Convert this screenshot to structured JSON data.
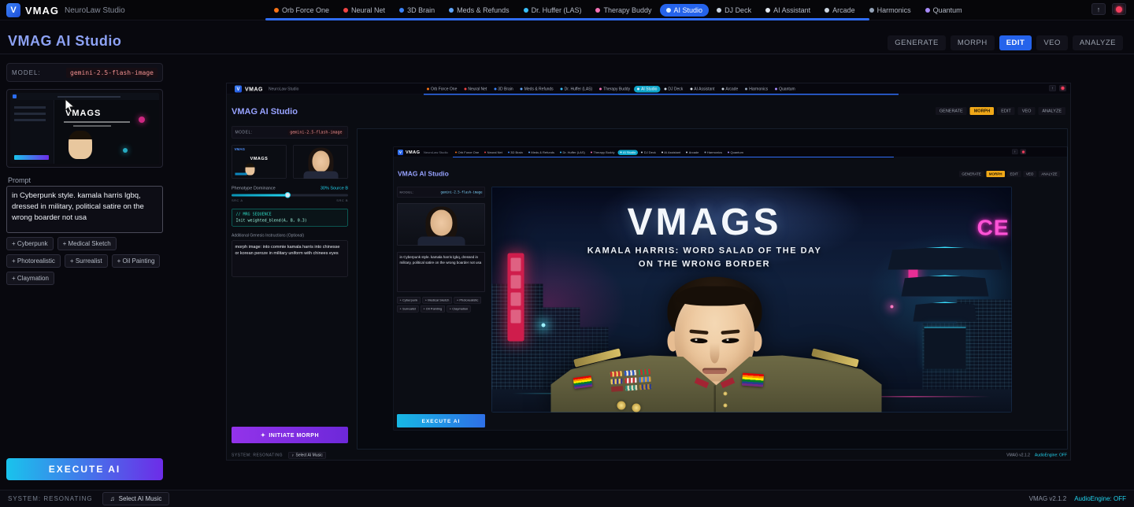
{
  "app": {
    "logo_letter": "V",
    "brand": "VMAG",
    "subtitle": "NeuroLaw Studio",
    "title": "VMAG AI Studio",
    "system_status": "SYSTEM: RESONATING",
    "music_button": "Select AI Music",
    "version": "VMAG v2.1.2",
    "audio_engine": "AudioEngine: OFF"
  },
  "icons": {
    "music": "♫",
    "note": "♪",
    "up_arrow": "↑",
    "sparkle": "✦"
  },
  "nav": {
    "items": [
      {
        "label": "Orb Force One",
        "color": "#f97316"
      },
      {
        "label": "Neural Net",
        "color": "#ef4444"
      },
      {
        "label": "3D Brain",
        "color": "#3b82f6"
      },
      {
        "label": "Meds & Refunds",
        "color": "#60a5fa"
      },
      {
        "label": "Dr. Huffer (LAS)",
        "color": "#38bdf8"
      },
      {
        "label": "Therapy Buddy",
        "color": "#f472b6"
      },
      {
        "label": "AI Studio",
        "color": "#e0f2fe",
        "active": true
      },
      {
        "label": "DJ Deck",
        "color": "#cbd5e1"
      },
      {
        "label": "AI Assistant",
        "color": "#e2e8f0"
      },
      {
        "label": "Arcade",
        "color": "#cbd5e1"
      },
      {
        "label": "Harmonics",
        "color": "#94a3b8"
      },
      {
        "label": "Quantum",
        "color": "#a78bfa"
      }
    ]
  },
  "tabs_edit": {
    "items": [
      {
        "label": "GENERATE"
      },
      {
        "label": "MORPH"
      },
      {
        "label": "EDIT",
        "active": true
      },
      {
        "label": "VEO"
      },
      {
        "label": "ANALYZE"
      }
    ]
  },
  "tabs_morph": {
    "items": [
      {
        "label": "GENERATE"
      },
      {
        "label": "MORPH",
        "active": true
      },
      {
        "label": "EDIT"
      },
      {
        "label": "VEO"
      },
      {
        "label": "ANALYZE"
      }
    ]
  },
  "sidebar": {
    "model_label": "MODEL:",
    "model_value": "gemini-2.5-flash-image",
    "prompt_label": "Prompt",
    "prompt_value": "in Cyberpunk style. kamala harris lgbq, dressed in military, political satire on the wrong boarder not usa",
    "chips": [
      {
        "label": "+ Cyberpunk"
      },
      {
        "label": "+ Medical Sketch"
      },
      {
        "label": "+ Photorealistic"
      },
      {
        "label": "+ Surrealist"
      },
      {
        "label": "+ Oil Painting"
      },
      {
        "label": "+ Claymation"
      }
    ],
    "execute_label": "EXECUTE AI"
  },
  "level1": {
    "slider_label": "Phenotype Dominance",
    "slider_value": "30% Source B",
    "slider_min": "SRC A",
    "slider_max": "SRC B",
    "code_line1": "// MRG SEQUENCE",
    "code_line2": "Init weighted_blend(A, B, 0.3)",
    "instructions_label": "Additional Genesis Instructions (Optional)",
    "instructions_value": "morph image: into commie kamala harris into chinesse or korean peroze in military uniform with chinees eyes",
    "morph_button": "INITIATE MORPH"
  },
  "artwork": {
    "title": "VMAGS",
    "subtitle_line1": "KAMALA HARRIS: WORD SALAD OF THE DAY",
    "subtitle_line2": "ON THE WRONG BORDER",
    "neon_sign": "CE"
  }
}
